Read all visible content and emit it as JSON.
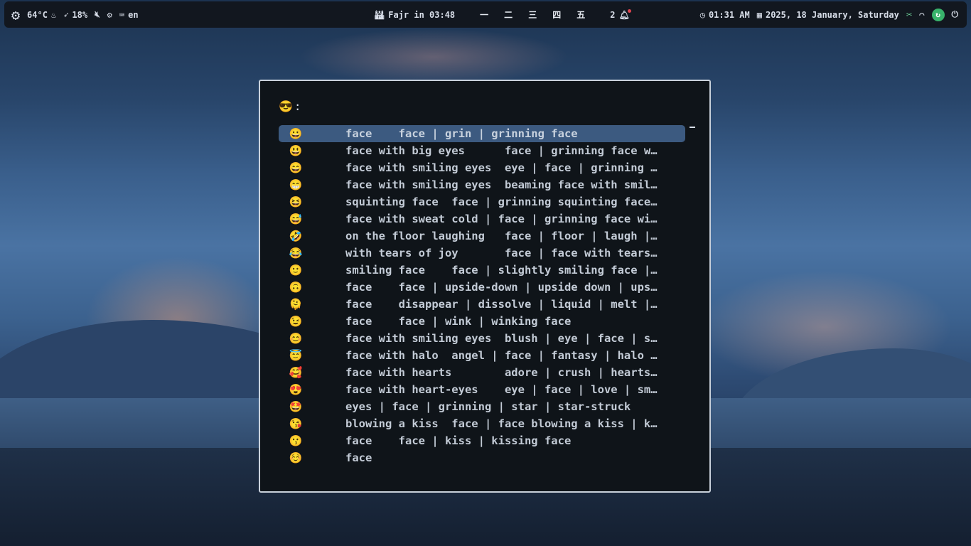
{
  "topbar": {
    "left": {
      "menu_icon": "gear-icon",
      "temperature": "64°C",
      "brightness": "18%",
      "keyboard_layout": "en"
    },
    "center": {
      "prayer": "Fajr in 03:48",
      "workspaces": [
        "一",
        "二",
        "三",
        "四",
        "五"
      ],
      "notification_count": "2"
    },
    "right": {
      "time": "01:31 AM",
      "date": "2025, 18 January, Saturday"
    }
  },
  "launcher": {
    "prompt_emoji": "😎",
    "prompt_suffix": ":",
    "items": [
      {
        "emoji": "😀",
        "text": "face    face | grin | grinning face",
        "selected": true
      },
      {
        "emoji": "😃",
        "text": "face with big eyes      face | grinning face w…"
      },
      {
        "emoji": "😄",
        "text": "face with smiling eyes  eye | face | grinning …"
      },
      {
        "emoji": "😁",
        "text": "face with smiling eyes  beaming face with smil…"
      },
      {
        "emoji": "😆",
        "text": "squinting face  face | grinning squinting face…"
      },
      {
        "emoji": "😅",
        "text": "face with sweat cold | face | grinning face wi…"
      },
      {
        "emoji": "🤣",
        "text": "on the floor laughing   face | floor | laugh |…"
      },
      {
        "emoji": "😂",
        "text": "with tears of joy       face | face with tears…"
      },
      {
        "emoji": "🙂",
        "text": "smiling face    face | slightly smiling face |…"
      },
      {
        "emoji": "🙃",
        "text": "face    face | upside-down | upside down | ups…"
      },
      {
        "emoji": "🫠",
        "text": "face    disappear | dissolve | liquid | melt |…"
      },
      {
        "emoji": "😉",
        "text": "face    face | wink | winking face"
      },
      {
        "emoji": "😊",
        "text": "face with smiling eyes  blush | eye | face | s…"
      },
      {
        "emoji": "😇",
        "text": "face with halo  angel | face | fantasy | halo …"
      },
      {
        "emoji": "🥰",
        "text": "face with hearts        adore | crush | hearts…"
      },
      {
        "emoji": "😍",
        "text": "face with heart-eyes    eye | face | love | sm…"
      },
      {
        "emoji": "🤩",
        "text": "eyes | face | grinning | star | star-struck"
      },
      {
        "emoji": "😘",
        "text": "blowing a kiss  face | face blowing a kiss | k…"
      },
      {
        "emoji": "😗",
        "text": "face    face | kiss | kissing face"
      },
      {
        "emoji": "☺️",
        "text": "face"
      }
    ]
  }
}
